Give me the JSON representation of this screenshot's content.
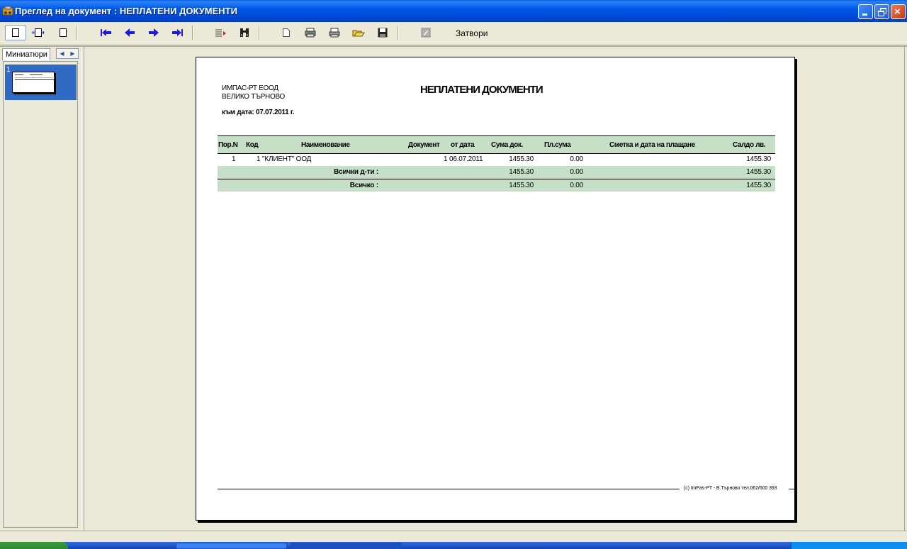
{
  "window": {
    "title": "Преглед на документ : НЕПЛАТЕНИ ДОКУМЕНТИ"
  },
  "toolbar": {
    "close_label": "Затвори",
    "buttons": [
      "single-page-icon",
      "page-width-icon",
      "two-pages-icon",
      "first-page-icon",
      "prev-page-icon",
      "next-page-icon",
      "last-page-icon",
      "goto-page-icon",
      "find-icon",
      "new-page-icon",
      "print-setup-icon",
      "print-icon",
      "open-icon",
      "save-icon",
      "edit-icon"
    ]
  },
  "left_panel": {
    "tab_label": "Миниатюри",
    "thumbnail_number": "1"
  },
  "report": {
    "company_line1": "ИМПАС-РТ ЕООД",
    "company_line2": "ВЕЛИКО ТЪРНОВО",
    "as_of": "към дата: 07.07.2011 г.",
    "title": "НЕПЛАТЕНИ ДОКУМЕНТИ",
    "columns": {
      "num": "Пор.N",
      "code": "Код",
      "name": "Наименование",
      "document": "Документ",
      "date": "от дата",
      "amount": "Сума док.",
      "paid": "Пл.сума",
      "account": "Сметка и дата на плащане",
      "balance": "Салдо лв."
    },
    "rows": [
      {
        "num": "1",
        "code": "1",
        "name": "\"КЛИЕНТ\" ООД",
        "document": "1",
        "date": "06.07.2011",
        "amount": "1455.30",
        "paid": "0.00",
        "account": "",
        "balance": "1455.30"
      }
    ],
    "subtotal": {
      "label": "Всички д-ти :",
      "amount": "1455.30",
      "paid": "0.00",
      "balance": "1455.30"
    },
    "total": {
      "label": "Всичко :",
      "amount": "1455.30",
      "paid": "0.00",
      "balance": "1455.30"
    },
    "footer": "(c) ImPas-PT - В.Търново тел.062/600 393"
  },
  "colors": {
    "title_bar": "#0058e6",
    "band": "#c6e0c8",
    "nav_arrows": "#1c1cd8",
    "selection": "#316ac5"
  }
}
